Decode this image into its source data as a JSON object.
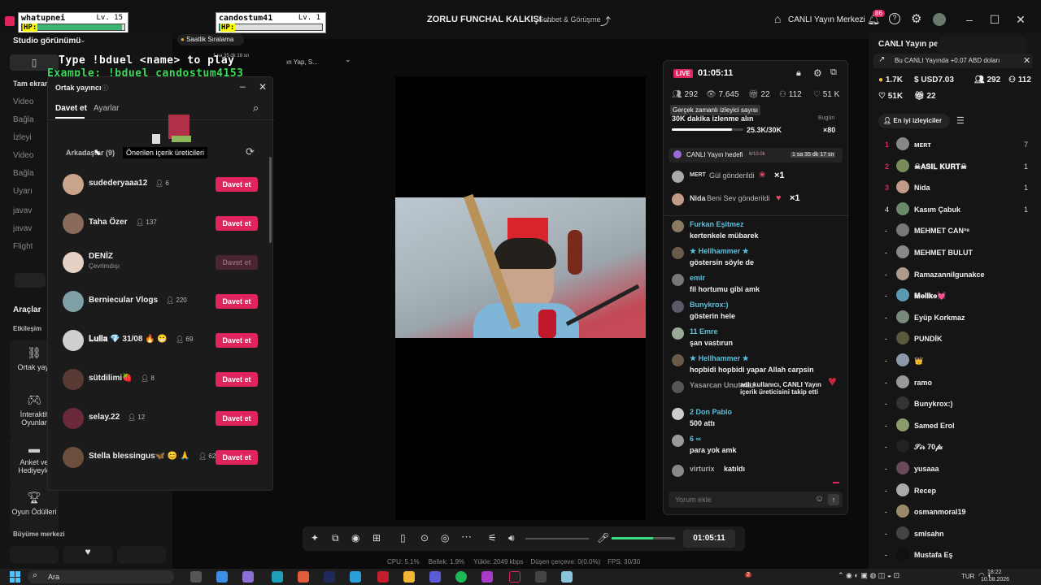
{
  "overlay_game": {
    "player1": {
      "name": "whatupnei",
      "level": "Lv. 15",
      "hp_label": "HP:",
      "hp_fraction": 0.98
    },
    "player2": {
      "name": "candostum41",
      "level": "Lv. 1",
      "hp_label": "HP:",
      "hp_fraction": 0.01
    },
    "line1": "Type !bduel <name> to play",
    "line2": "Example: !bduel candostum4153"
  },
  "titlebar": {
    "title": "ZORLU FUNCHAL KALKIŞI ...",
    "subtitle": "Sohbet & Görüşme",
    "center_label": "CANLI Yayın Merkezi",
    "notif_count": "86"
  },
  "left_sidebar": {
    "studio_view": "Studio görünümü",
    "hourly_ranking": "Saatlik Sıralama",
    "time_label": "1 sa 35 dk 16 sn",
    "partial_right": "ın Yap, S...",
    "tam_ekran": "Tam ekran",
    "faded_items": [
      "Video",
      "Bağla",
      "İzleyi",
      "Video",
      "Bağla",
      "Uyarı",
      "javav",
      "javav",
      "Flight"
    ],
    "araclar": "Araçlar",
    "etkilesim": "Etkileşim",
    "tools": [
      {
        "label": "Ortak yayı",
        "icon": "link-icon"
      },
      {
        "label": "İnteraktif Oyunlar",
        "icon": "gamepad-icon"
      },
      {
        "label": "Anket ve Hediyeyle",
        "icon": "poll-icon"
      },
      {
        "label": "Oyun Ödülleri",
        "icon": "trophy-icon"
      }
    ],
    "buyume": "Büyüme merkezi"
  },
  "popup": {
    "title": "Ortak yayıncı",
    "tab_active": "Davet et",
    "tab_other": "Ayarlar",
    "friends_label": "Arkadaşlar (9)",
    "tooltip": "Önerilen içerik üreticileri",
    "rows": [
      {
        "name": "sudederyaaa12",
        "count": "6",
        "status": "",
        "button": "Davet et",
        "disabled": false,
        "color": "#c7a48a"
      },
      {
        "name": "Taha Özer",
        "count": "137",
        "status": "",
        "button": "Davet et",
        "disabled": false,
        "color": "#8a6a5a"
      },
      {
        "name": "DENİZ",
        "count": "",
        "status": "Çevrimdışı",
        "button": "Davet et",
        "disabled": true,
        "color": "#e6d2c4"
      },
      {
        "name": "Berniecular Vlogs",
        "count": "220",
        "status": "",
        "button": "Davet et",
        "disabled": false,
        "color": "#7fa0a6"
      },
      {
        "name": "𝐋𝐮𝐥𝐥𝐚 💎 31/08 🔥 😁",
        "count": "69",
        "status": "",
        "button": "Davet et",
        "disabled": false,
        "color": "#cfcfcf"
      },
      {
        "name": "sütdilimi🍓",
        "count": "8",
        "status": "",
        "button": "Davet et",
        "disabled": false,
        "color": "#5a3a34"
      },
      {
        "name": "selay.22",
        "count": "12",
        "status": "",
        "button": "Davet et",
        "disabled": false,
        "color": "#6a2a3a"
      },
      {
        "name": "Stella blessingus🦋 😊 🙏",
        "count": "62",
        "status": "",
        "button": "Davet et",
        "disabled": false,
        "color": "#6b4e3c"
      }
    ]
  },
  "chat": {
    "live_badge": "LIVE",
    "timer": "01:05:11",
    "stats": [
      "292",
      "7.645",
      "22",
      "112",
      "51 K"
    ],
    "tooltip": "Gerçek zamanlı izleyici sayısı",
    "goal_text": "30K dakika izlenme alın",
    "goal_value": "25.3K/30K",
    "goal_fraction": 0.84,
    "today_label": "Bugün",
    "today_mult": "×80",
    "live_goal": "CANLI Yayın hedefi",
    "live_goal_progress": "6/10.0k",
    "live_goal_time": "1 sa 35 dk 17 sn",
    "gifts": [
      {
        "user": "MERT",
        "text": "Gül gönderildi",
        "mult": "×1",
        "color": "#aaa"
      },
      {
        "user": "Nida",
        "text": "Beni Sev gönderildi",
        "mult": "×1",
        "color": "#c29b88"
      }
    ],
    "messages": [
      {
        "user": "Furkan Eşitmez",
        "text": "kertenkele mübarek",
        "color": "#8a7a62"
      },
      {
        "user": "★ Hellhammer ★",
        "text": "göstersin söyle de",
        "color": "#6a5a4a"
      },
      {
        "user": "emir",
        "text": "fil hortumu gibi amk",
        "color": "#777"
      },
      {
        "user": "Bunykrox:)",
        "text": "gösterin hele",
        "color": "#5a5a6a"
      },
      {
        "user": "11 Emre",
        "text": "şan vastırun",
        "color": "#9a9"
      },
      {
        "user": "★ Hellhammer ★",
        "text": "hopbidi hopbidi yapar Allah carpsin",
        "color": "#6a5a4a"
      },
      {
        "user": "Yasarcan Unutmaz",
        "text": "adlı kullanıcı, CANLI Yayın içerik üreticisini takip etti",
        "color": "#555"
      },
      {
        "user": "2 Don Pablo",
        "text": "500 attı",
        "color": "#ccc"
      },
      {
        "user": "6 ∞",
        "text": "para yok amk",
        "color": "#999"
      },
      {
        "user": "virturix",
        "text": "katıldı",
        "color": "#888"
      }
    ],
    "comment_placeholder": "Yorum ekle"
  },
  "board": {
    "title": "CANLI Yayın pe...",
    "promo": "Bu CANLI Yayında +0.07 ABD doları",
    "stats1": [
      "1.7K",
      "USD7.03",
      "292",
      "112"
    ],
    "stats2": [
      "51K",
      "22"
    ],
    "tab": "En iyi izleyiciler",
    "rows": [
      {
        "rank": "1",
        "name": "ᴍᴇʀᴛ",
        "score": "7",
        "color": "#888"
      },
      {
        "rank": "2",
        "name": "☠𝐀𝐒𝐈𝐋 𝐊𝐔𝐑𝐓☠",
        "score": "1",
        "color": "#7a8a5a"
      },
      {
        "rank": "3",
        "name": "Nida",
        "score": "1",
        "color": "#c29b88"
      },
      {
        "rank": "4",
        "name": "Kasım Çabuk",
        "score": "1",
        "color": "#6a8a6a"
      },
      {
        "rank": "-",
        "name": "MEHMET CAN³⁸",
        "score": "",
        "color": "#777"
      },
      {
        "rank": "-",
        "name": "MEHMET BULUT",
        "score": "",
        "color": "#888"
      },
      {
        "rank": "-",
        "name": "Ramazannilgunakce",
        "score": "",
        "color": "#b09a8a"
      },
      {
        "rank": "-",
        "name": "𝐌𝐞𝐥𝐢𝐤𝐞💓",
        "score": "",
        "color": "#5a9ab0"
      },
      {
        "rank": "-",
        "name": "Eyüp Korkmaz",
        "score": "",
        "color": "#7a8a7a"
      },
      {
        "rank": "-",
        "name": "PUNDİK",
        "score": "",
        "color": "#5a5a3a"
      },
      {
        "rank": "-",
        "name": "👑",
        "score": "",
        "color": "#8a9aaa"
      },
      {
        "rank": "-",
        "name": "ramo",
        "score": "",
        "color": "#999"
      },
      {
        "rank": "-",
        "name": "Bunykrox:)",
        "score": "",
        "color": "#333"
      },
      {
        "rank": "-",
        "name": "Samed Erol",
        "score": "",
        "color": "#8a9a6a"
      },
      {
        "rank": "-",
        "name": "𝒮𝒾𝓇 70𝒻𝒶",
        "score": "",
        "color": "#222"
      },
      {
        "rank": "-",
        "name": "yusaaa",
        "score": "",
        "color": "#6a4a5a"
      },
      {
        "rank": "-",
        "name": "Recep",
        "score": "",
        "color": "#aaa"
      },
      {
        "rank": "-",
        "name": "osmanmoral19",
        "score": "",
        "color": "#9a8a6a"
      },
      {
        "rank": "-",
        "name": "smlsahn",
        "score": "",
        "color": "#444"
      },
      {
        "rank": "-",
        "name": "Mustafa Eş",
        "score": "",
        "color": "#111"
      }
    ]
  },
  "controls": {
    "time": "01:05:11",
    "volume_fraction": 0.65
  },
  "perf": {
    "cpu": "CPU: 5.1%",
    "ram": "Bellek: 1.9%",
    "upload": "Yükle: 2049 kbps",
    "dropped": "Düşen çerçeve: 0(0.0%)",
    "fps": "FPS: 30/30"
  },
  "taskbar": {
    "search": "Ara",
    "lang": "TUR",
    "time": "18:22",
    "date": "10.08.2026",
    "badge": "2"
  },
  "colors": {
    "accent": "#e0245e",
    "bg": "#0b0b0b"
  }
}
